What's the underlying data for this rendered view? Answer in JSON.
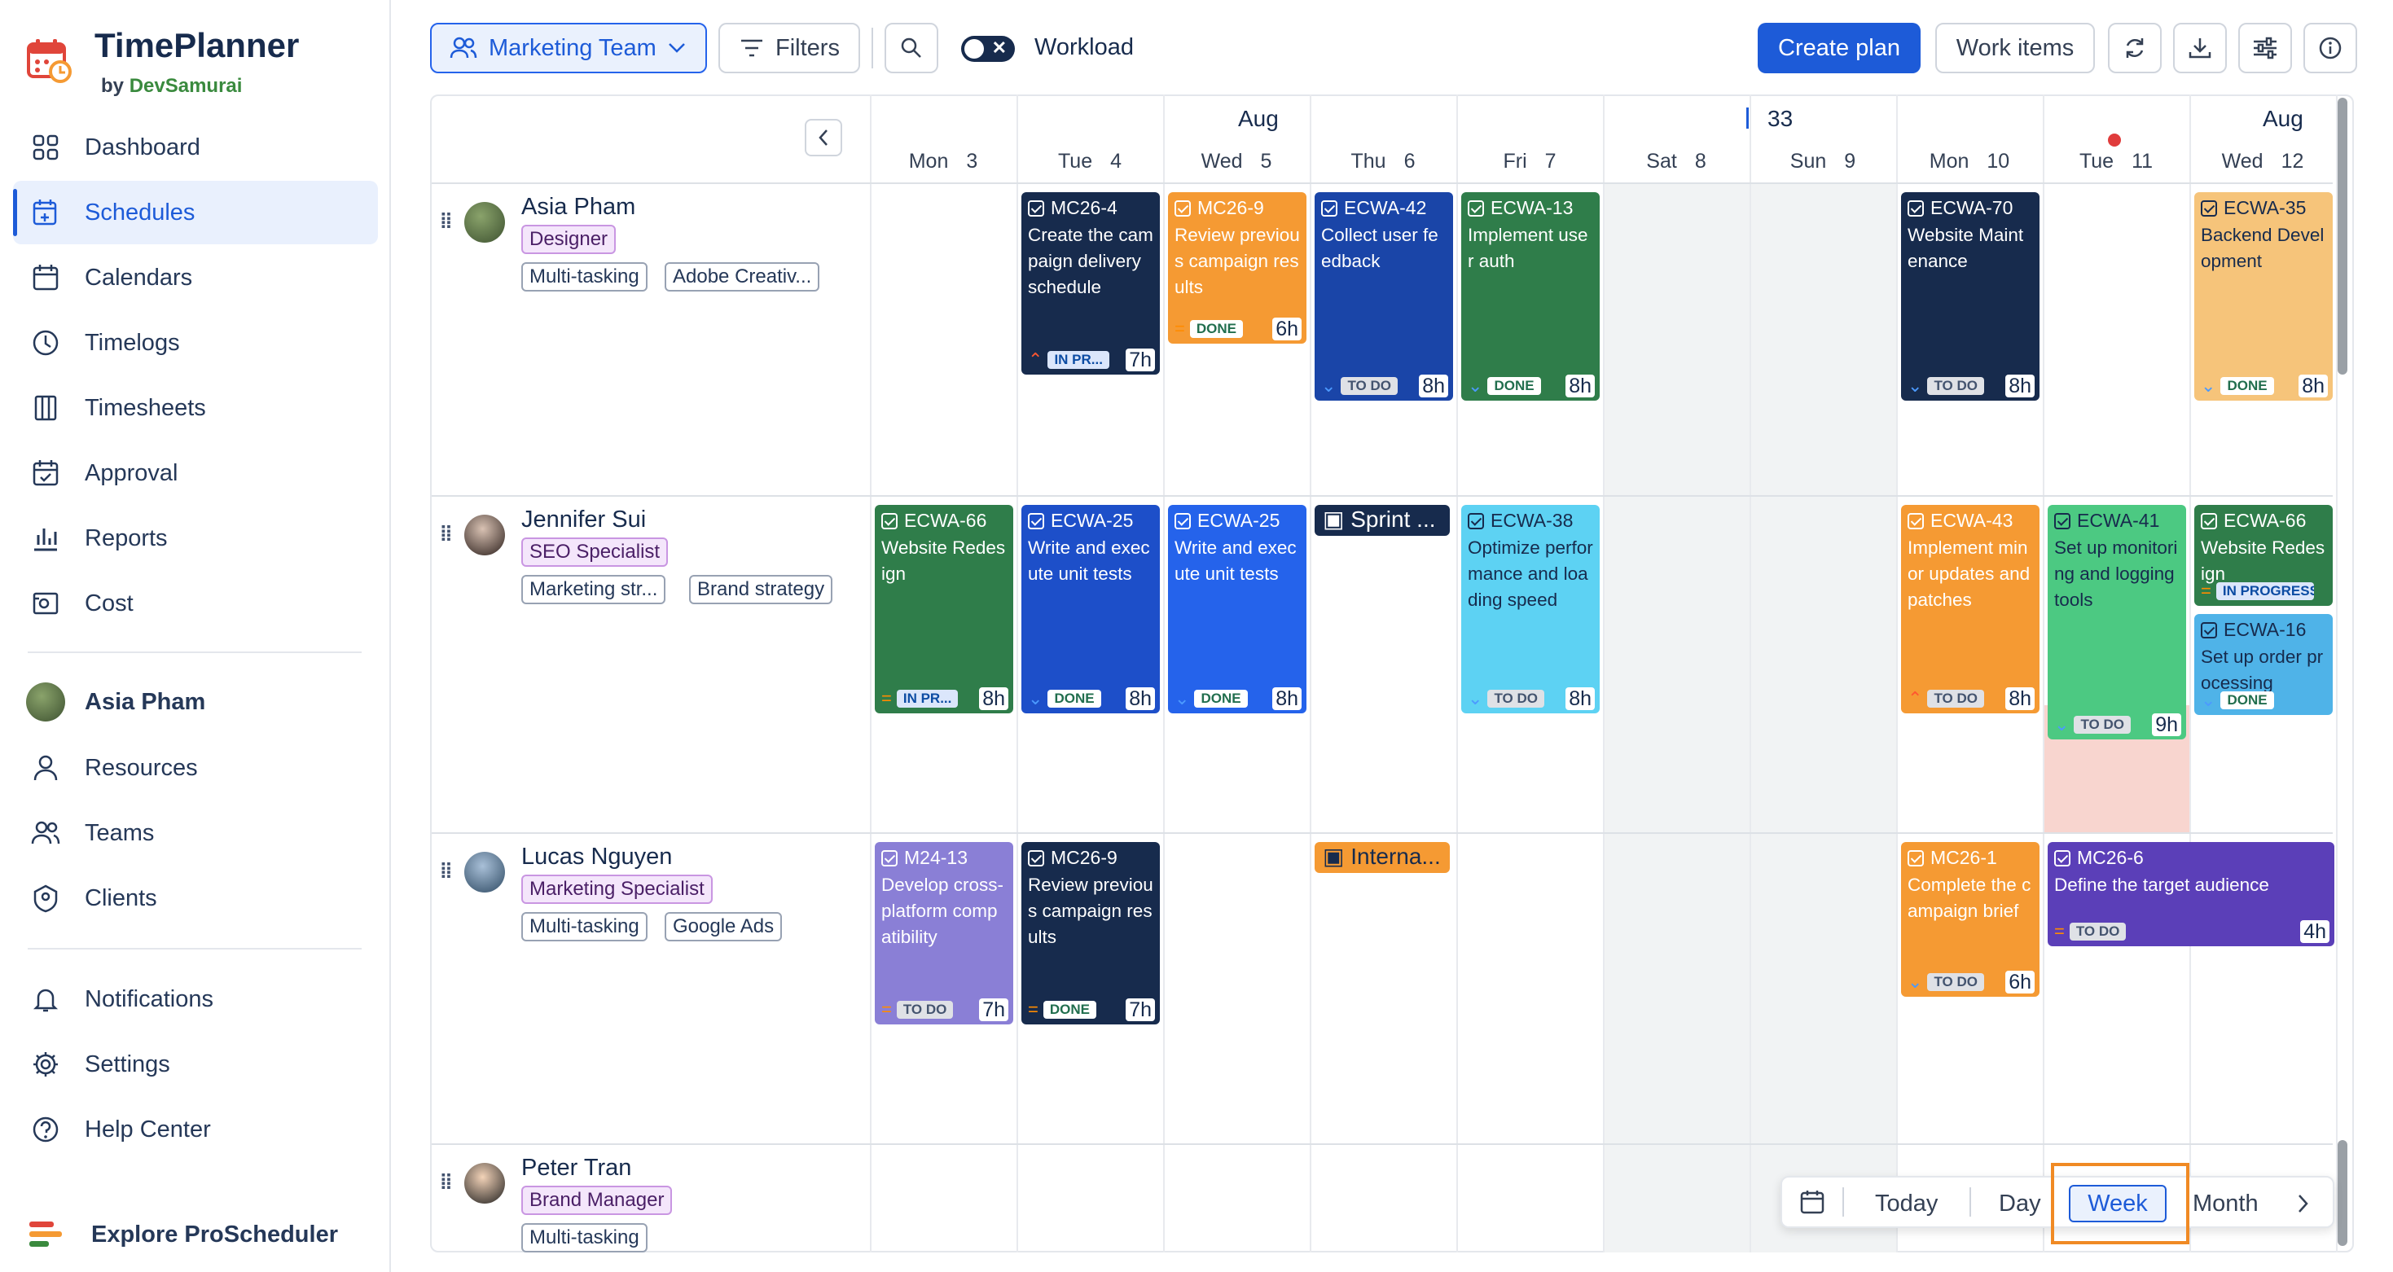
{
  "app": {
    "name": "TimePlanner",
    "by": "by",
    "vendor": "DevSamurai"
  },
  "sidebar": {
    "items": [
      {
        "label": "Dashboard",
        "icon": "dashboard-icon"
      },
      {
        "label": "Schedules",
        "icon": "schedules-icon",
        "active": true
      },
      {
        "label": "Calendars",
        "icon": "calendar-icon"
      },
      {
        "label": "Timelogs",
        "icon": "clock-icon"
      },
      {
        "label": "Timesheets",
        "icon": "timesheet-icon"
      },
      {
        "label": "Approval",
        "icon": "approval-icon"
      },
      {
        "label": "Reports",
        "icon": "reports-icon"
      },
      {
        "label": "Cost",
        "icon": "cost-icon"
      }
    ],
    "user": "Asia Pham",
    "items2": [
      {
        "label": "Resources",
        "icon": "user-icon"
      },
      {
        "label": "Teams",
        "icon": "teams-icon"
      },
      {
        "label": "Clients",
        "icon": "clients-icon"
      }
    ],
    "items3": [
      {
        "label": "Notifications",
        "icon": "bell-icon"
      },
      {
        "label": "Settings",
        "icon": "gear-icon"
      },
      {
        "label": "Help Center",
        "icon": "help-icon"
      }
    ],
    "explore": "Explore ProScheduler"
  },
  "toolbar": {
    "team": "Marketing Team",
    "filters": "Filters",
    "workload": "Workload",
    "create_plan": "Create plan",
    "work_items": "Work items"
  },
  "calendar": {
    "month_left": "Aug",
    "month_right": "Aug",
    "week_number": "33",
    "days": [
      {
        "dow": "Mon",
        "d": "3"
      },
      {
        "dow": "Tue",
        "d": "4"
      },
      {
        "dow": "Wed",
        "d": "5"
      },
      {
        "dow": "Thu",
        "d": "6"
      },
      {
        "dow": "Fri",
        "d": "7"
      },
      {
        "dow": "Sat",
        "d": "8"
      },
      {
        "dow": "Sun",
        "d": "9"
      },
      {
        "dow": "Mon",
        "d": "10"
      },
      {
        "dow": "Tue",
        "d": "11"
      },
      {
        "dow": "Wed",
        "d": "12"
      }
    ]
  },
  "resources": [
    {
      "name": "Asia Pham",
      "role": "Designer",
      "skills": [
        "Multi-tasking",
        "Adobe Creativ..."
      ]
    },
    {
      "name": "Jennifer Sui",
      "role": "SEO Specialist",
      "skills": [
        "Marketing str...",
        "Brand strategy"
      ]
    },
    {
      "name": "Lucas Nguyen",
      "role": "Marketing Specialist",
      "skills": [
        "Multi-tasking",
        "Google Ads"
      ]
    },
    {
      "name": "Peter Tran",
      "role": "Brand Manager",
      "skills": [
        "Multi-tasking"
      ]
    }
  ],
  "tasks": {
    "r0": [
      {
        "key": "MC26-4",
        "title": "Create the campaign delivery schedule",
        "status": "IN PR...",
        "hours": "7h",
        "prio": "high",
        "color": "#172b4d"
      },
      {
        "key": "MC26-9",
        "title": "Review previous campaign results",
        "status": "DONE",
        "hours": "6h",
        "prio": "med",
        "color": "#f59a33"
      },
      {
        "key": "ECWA-42",
        "title": "Collect user feedback",
        "status": "TO DO",
        "hours": "8h",
        "prio": "low",
        "color": "#1a45a8"
      },
      {
        "key": "ECWA-13",
        "title": "Implement user auth",
        "status": "DONE",
        "hours": "8h",
        "prio": "low",
        "color": "#2f7d4a"
      },
      {
        "key": "ECWA-70",
        "title": "Website Maintenance",
        "status": "TO DO",
        "hours": "8h",
        "prio": "low",
        "color": "#172b4d"
      },
      {
        "key": "ECWA-35",
        "title": "Backend Development",
        "status": "DONE",
        "hours": "8h",
        "prio": "low",
        "color": "#f6c47a"
      }
    ],
    "r1": [
      {
        "key": "ECWA-66",
        "title": "Website Redesign",
        "status": "IN PR...",
        "hours": "8h",
        "prio": "med",
        "color": "#2f7d4a"
      },
      {
        "key": "ECWA-25",
        "title": "Write and execute unit tests",
        "status": "DONE",
        "hours": "8h",
        "prio": "low",
        "color": "#1d4fc9"
      },
      {
        "key": "ECWA-25",
        "title": "Write and execute unit tests",
        "status": "DONE",
        "hours": "8h",
        "prio": "low",
        "color": "#2563eb"
      },
      {
        "key": "ECWA-38",
        "title": "Optimize performance and loading speed",
        "status": "TO DO",
        "hours": "8h",
        "prio": "low",
        "color": "#5dd2f3"
      },
      {
        "key": "ECWA-43",
        "title": "Implement minor updates and patches",
        "status": "TO DO",
        "hours": "8h",
        "prio": "high",
        "color": "#f59a33"
      },
      {
        "key": "ECWA-41",
        "title": "Set up monitoring and logging tools",
        "status": "TO DO",
        "hours": "9h",
        "prio": "low",
        "color": "#4cc982"
      },
      {
        "key": "ECWA-66",
        "title": "Website Redesign",
        "status": "IN PROGRESS",
        "hours": "",
        "prio": "med",
        "color": "#2f7d4a"
      },
      {
        "key": "ECWA-16",
        "title": "Set up order processing",
        "status": "DONE",
        "hours": "",
        "prio": "low",
        "color": "#4fb3e8"
      }
    ],
    "r2": [
      {
        "key": "M24-13",
        "title": "Develop cross-platform compatibility",
        "status": "TO DO",
        "hours": "7h",
        "prio": "med",
        "color": "#8a7fd6"
      },
      {
        "key": "MC26-9",
        "title": "Review previous campaign results",
        "status": "DONE",
        "hours": "7h",
        "prio": "med",
        "color": "#172b4d"
      },
      {
        "key": "MC26-1",
        "title": "Complete the campaign brief",
        "status": "TO DO",
        "hours": "6h",
        "prio": "low",
        "color": "#f59a33"
      },
      {
        "key": "MC26-6",
        "title": "Define the target audience",
        "status": "TO DO",
        "hours": "4h",
        "prio": "med",
        "color": "#5b3fb8"
      }
    ]
  },
  "events": [
    {
      "label": "Sprint ...",
      "color": "#172b4d"
    },
    {
      "label": "Interna...",
      "color": "#f59a33"
    }
  ],
  "viewbar": {
    "today": "Today",
    "day": "Day",
    "week": "Week",
    "month": "Month"
  }
}
